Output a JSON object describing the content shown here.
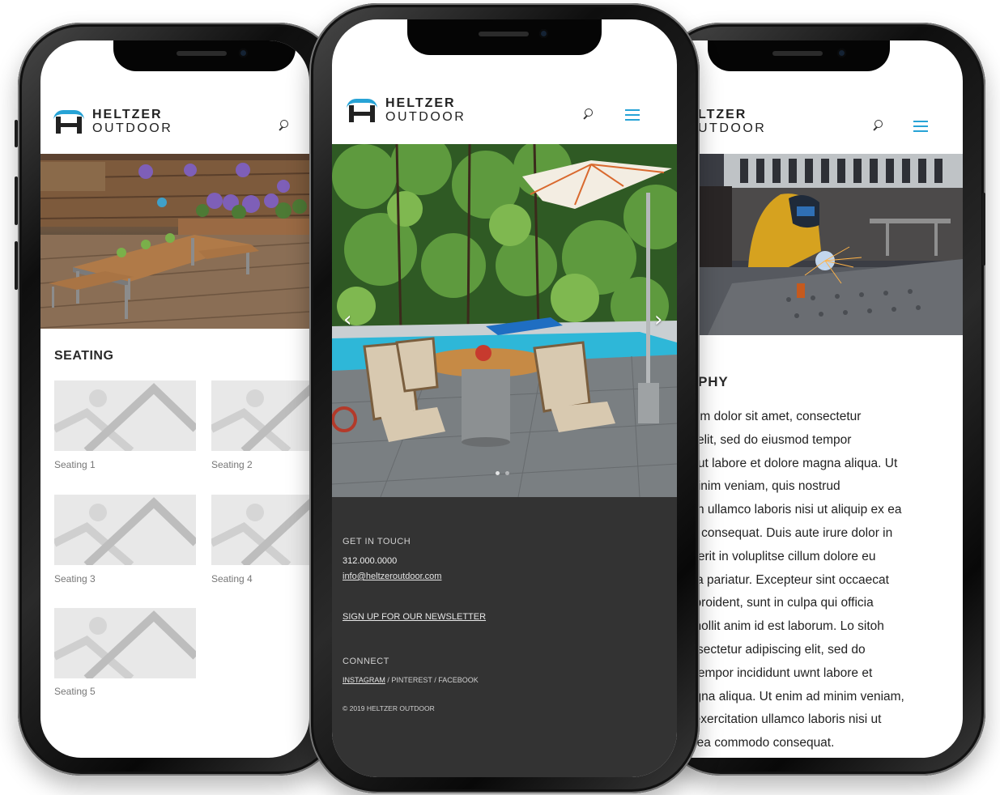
{
  "brand": {
    "line1": "HELTZER",
    "line2": "OUTDOOR",
    "accent_color": "#27a3d6"
  },
  "left_screen": {
    "section_title": "SEATING",
    "items": [
      {
        "label": "Seating 1"
      },
      {
        "label": "Seating 2"
      },
      {
        "label": "Seating 3"
      },
      {
        "label": "Seating 4"
      },
      {
        "label": "Seating 5"
      }
    ],
    "icons": [
      "search-icon",
      "image-placeholder-icon"
    ]
  },
  "center_screen": {
    "icons": [
      "search-icon",
      "hamburger-menu-icon",
      "chevron-left-icon",
      "chevron-right-icon"
    ],
    "footer": {
      "contact_heading": "GET IN TOUCH",
      "phone": "312.000.0000",
      "email": "info@heltzeroutdoor.com",
      "newsletter": "SIGN UP FOR OUR NEWSLETTER",
      "connect_heading": "CONNECT",
      "social_instagram": "INSTAGRAM",
      "social_rest": " / PINTEREST / FACEBOOK",
      "copyright": "© 2019 HELTZER OUTDOOR",
      "background_color": "#333333"
    }
  },
  "right_screen": {
    "brand_line1": "LTZER",
    "brand_line2": "UTDOOR",
    "section_title": "SOPHY",
    "paragraph_lines": [
      "ipsum dolor sit amet, consectetur",
      "ing elit, sed do eiusmod tempor",
      "unt ut labore et dolore magna aliqua. Ut",
      "d minim veniam, quis nostrud",
      "ation ullamco laboris nisi ut aliquip ex ea",
      "odo consequat. Duis aute irure dolor in",
      "enderit in voluplitse cillum dolore eu",
      "nulla pariatur. Excepteur sint occaecat",
      "tat proident, sunt in culpa qui officia",
      "nt mollit anim id est laborum. Lo sitoh",
      "consectetur adipiscing elit, sed do",
      "od tempor incididunt uwnt labore et",
      "magna aliqua. Ut enim ad minim veniam,",
      "sd exercitation ullamco laboris nisi ut",
      "ex ea commodo consequat."
    ],
    "icons": [
      "search-icon",
      "hamburger-menu-icon"
    ]
  }
}
